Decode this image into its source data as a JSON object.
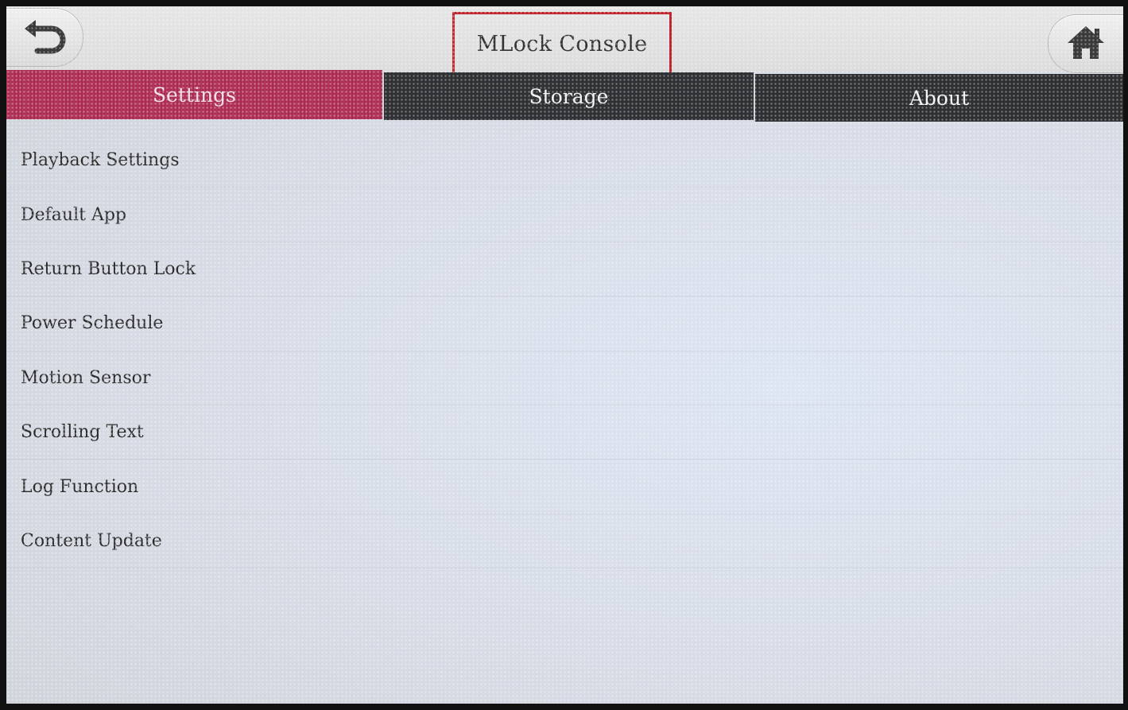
{
  "header": {
    "title": "MLock Console",
    "back_icon": "back-arrow-icon",
    "home_icon": "home-icon"
  },
  "tabs": [
    {
      "label": "Settings",
      "active": true
    },
    {
      "label": "Storage",
      "active": false
    },
    {
      "label": "About",
      "active": false
    }
  ],
  "settings_menu": [
    {
      "label": "Playback Settings"
    },
    {
      "label": "Default App"
    },
    {
      "label": "Return Button Lock"
    },
    {
      "label": "Power Schedule"
    },
    {
      "label": "Motion Sensor"
    },
    {
      "label": "Scrolling Text"
    },
    {
      "label": "Log Function"
    },
    {
      "label": "Content Update"
    }
  ],
  "colors": {
    "active_tab": "#b4345a",
    "inactive_tab": "#2f3134",
    "highlight_border": "#c0242b"
  }
}
